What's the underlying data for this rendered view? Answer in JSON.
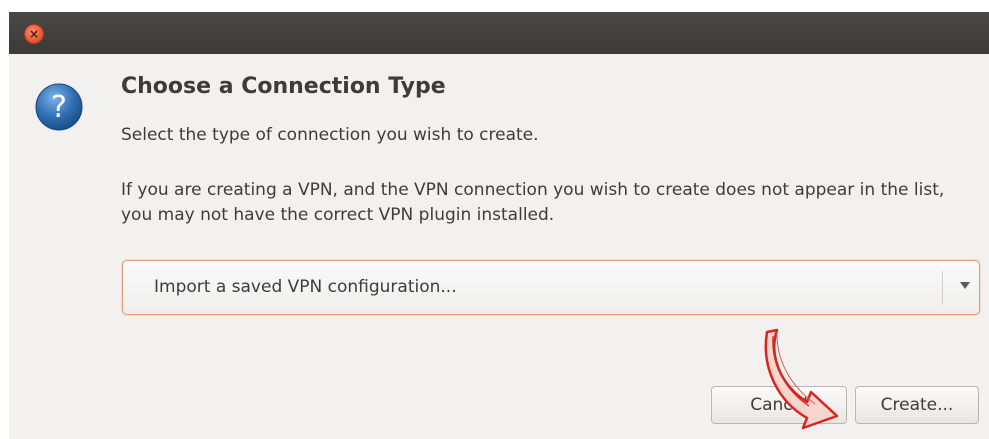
{
  "dialog": {
    "heading": "Choose a Connection Type",
    "subtext": "Select the type of connection you wish to create.",
    "info": "If you are creating a VPN, and the VPN connection you wish to create does not appear in the list, you may not have the correct VPN plugin installed."
  },
  "connection_type": {
    "selected": "Import a saved VPN configuration..."
  },
  "buttons": {
    "cancel": "Cancel",
    "create": "Create..."
  },
  "colors": {
    "titlebar": "#3b3a37",
    "close_button": "#e0542e",
    "combo_focus_border": "#e79a7b",
    "annotation_arrow": "#d7261e"
  },
  "icons": {
    "titlebar_close": "close-icon",
    "dialog_icon": "question-icon",
    "combo_dropdown": "dropdown-arrow-icon"
  }
}
